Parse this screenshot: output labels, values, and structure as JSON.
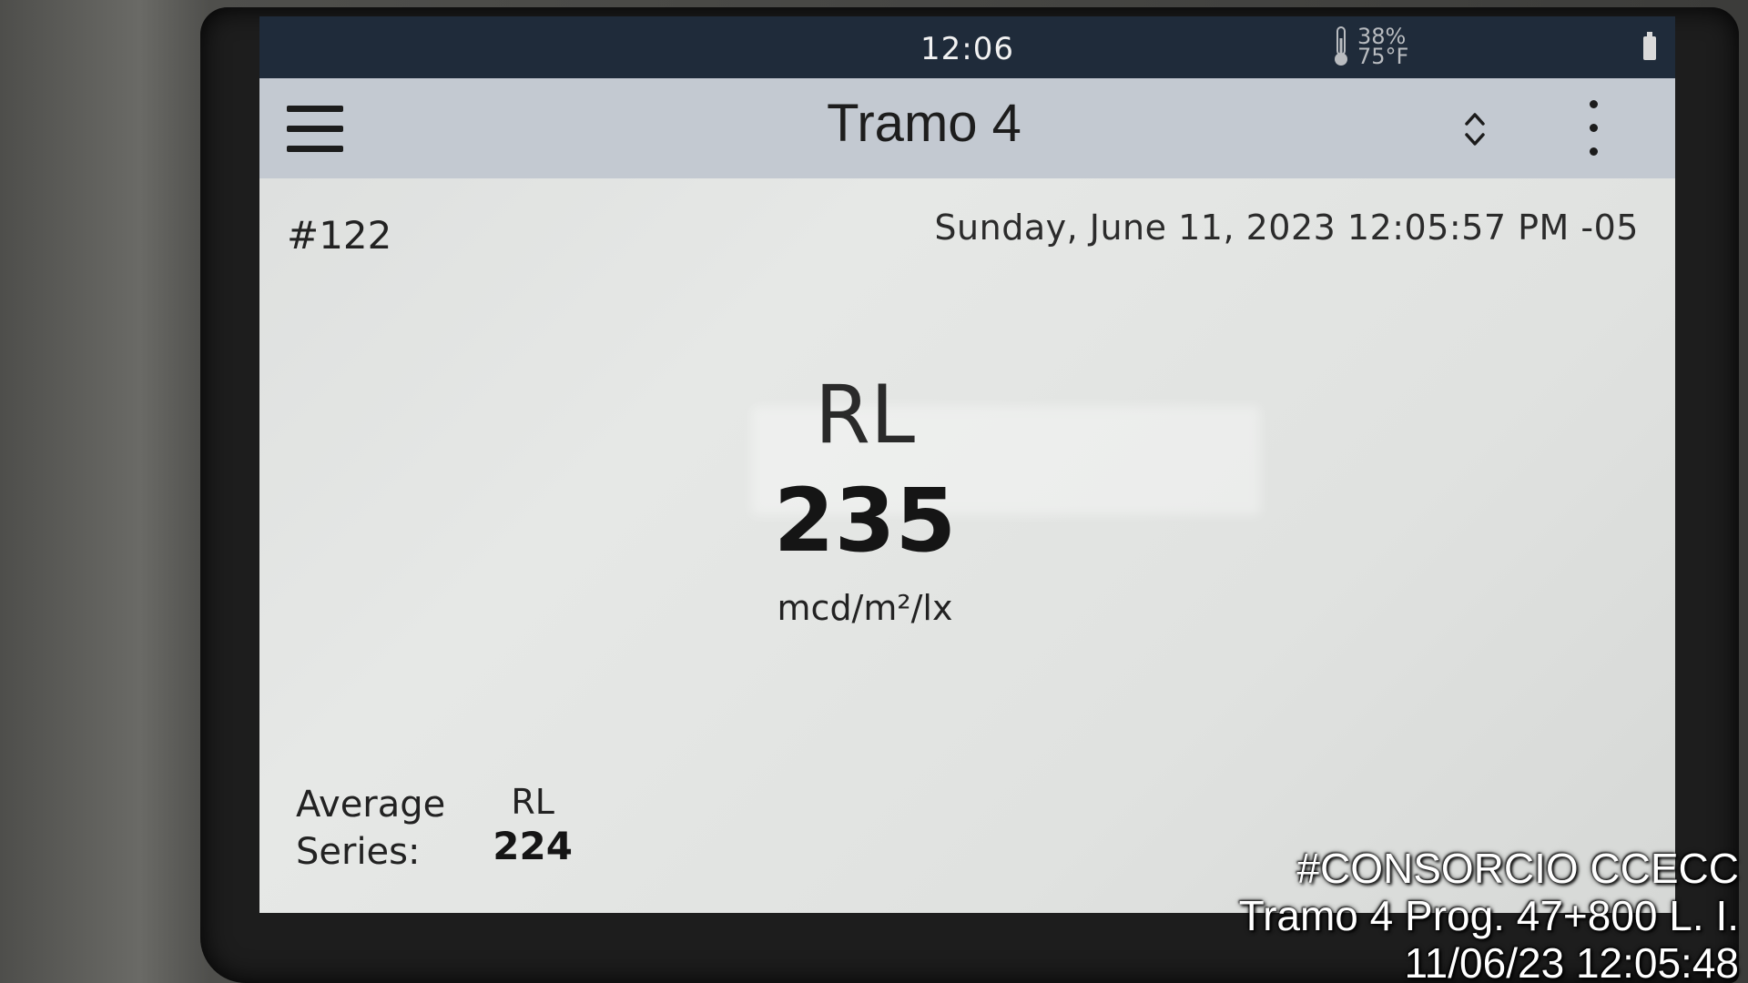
{
  "status_bar": {
    "time": "12:06",
    "humidity": "38%",
    "temperature": "75°F",
    "icons": [
      "thermometer-icon",
      "battery-icon"
    ]
  },
  "app_bar": {
    "title": "Tramo 4",
    "icons": [
      "menu-icon",
      "sort-icon",
      "more-options-icon"
    ]
  },
  "record": {
    "number": "#122",
    "timestamp": "Sunday, June 11, 2023 12:05:57 PM -05"
  },
  "measurement": {
    "label": "RL",
    "value": "235",
    "unit": "mcd/m²/lx"
  },
  "average": {
    "label_line1": "Average",
    "label_line2": "Series:",
    "metric": "RL",
    "value": "224"
  },
  "watermark": {
    "line1": "#CONSORCIO CCECC",
    "line2": "Tramo 4 Prog. 47+800 L. I.",
    "line3": "11/06/23  12:05:48"
  },
  "colors": {
    "status_bar_bg": "#1f2b3a",
    "app_bar_bg": "#c3c9d1",
    "screen_bg": "#e0e2e0"
  }
}
